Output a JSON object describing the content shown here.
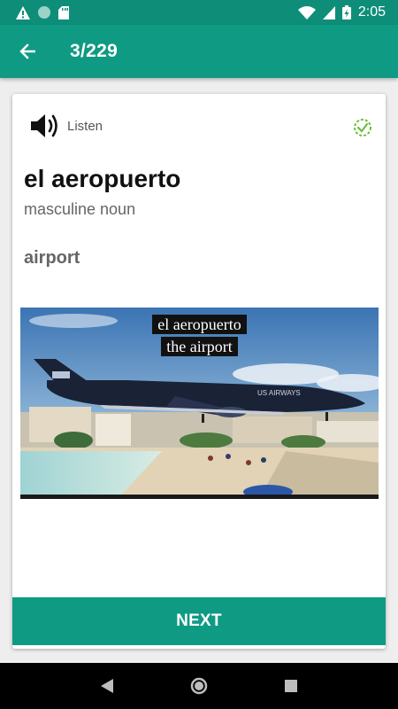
{
  "status_bar": {
    "time": "2:05",
    "icons": [
      "alert-icon",
      "circle-icon",
      "sd-card-icon",
      "wifi-icon",
      "cellular-icon",
      "battery-charging-icon"
    ]
  },
  "app_bar": {
    "title": "3/229",
    "back_icon": "arrow-left-icon"
  },
  "card": {
    "listen_label": "Listen",
    "word": "el aeropuerto",
    "word_type": "masculine noun",
    "translation": "airport",
    "picture": {
      "caption_top": "el aeropuerto",
      "caption_bottom": "the airport",
      "airline_text": "US AIRWAYS"
    },
    "next_label": "NEXT"
  },
  "colors": {
    "primary": "#0f9a83",
    "primary_dark": "#0e8e79",
    "progress_green": "#6cbf3c"
  },
  "nav_bar": {
    "icons": [
      "back-triangle-icon",
      "home-circle-icon",
      "recents-square-icon"
    ]
  }
}
